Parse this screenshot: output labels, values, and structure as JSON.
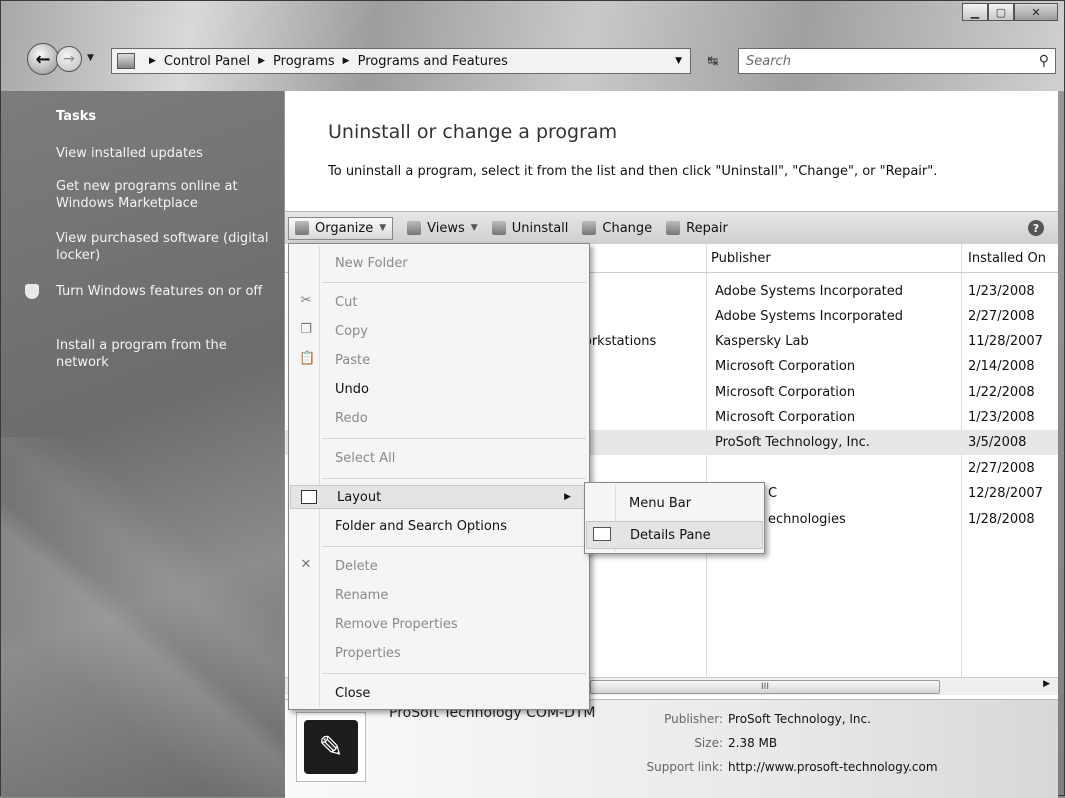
{
  "address": {
    "crumbs": [
      "Control Panel",
      "Programs",
      "Programs and Features"
    ],
    "search_placeholder": "Search"
  },
  "sidebar": {
    "heading": "Tasks",
    "items": [
      {
        "label": "View installed updates"
      },
      {
        "label": "Get new programs online at Windows Marketplace"
      },
      {
        "label": "View purchased software (digital locker)"
      },
      {
        "label": "Turn Windows features on or off"
      },
      {
        "label": "Install a program from the network"
      }
    ]
  },
  "main": {
    "title": "Uninstall or change a program",
    "description": "To uninstall a program, select it from the list and then click \"Uninstall\", \"Change\", or \"Repair\"."
  },
  "toolbar": {
    "organize": "Organize",
    "views": "Views",
    "uninstall": "Uninstall",
    "change": "Change",
    "repair": "Repair",
    "help": "?"
  },
  "table": {
    "columns": [
      "Publisher",
      "Installed On"
    ],
    "name_fragments": [
      "Vorkstations"
    ],
    "rows": [
      {
        "publisher": "Adobe Systems Incorporated",
        "installed": "1/23/2008"
      },
      {
        "publisher": "Adobe Systems Incorporated",
        "installed": "2/27/2008"
      },
      {
        "publisher": "Kaspersky Lab",
        "installed": "11/28/2007"
      },
      {
        "publisher": "Microsoft Corporation",
        "installed": "2/14/2008"
      },
      {
        "publisher": "Microsoft Corporation",
        "installed": "1/22/2008"
      },
      {
        "publisher": "Microsoft Corporation",
        "installed": "1/23/2008"
      },
      {
        "publisher": "ProSoft Technology, Inc.",
        "installed": "3/5/2008"
      },
      {
        "publisher": "",
        "installed": "2/27/2008"
      },
      {
        "publisher": "C",
        "installed": "12/28/2007"
      },
      {
        "publisher": "echnologies",
        "installed": "1/28/2008"
      }
    ]
  },
  "organize_menu": {
    "items": [
      {
        "label": "New Folder",
        "enabled": false
      },
      {
        "label": "Cut",
        "enabled": false
      },
      {
        "label": "Copy",
        "enabled": false
      },
      {
        "label": "Paste",
        "enabled": false
      },
      {
        "label": "Undo",
        "enabled": true
      },
      {
        "label": "Redo",
        "enabled": false
      },
      {
        "label": "Select All",
        "enabled": false
      },
      {
        "label": "Layout",
        "enabled": true
      },
      {
        "label": "Folder and Search Options",
        "enabled": true
      },
      {
        "label": "Delete",
        "enabled": false
      },
      {
        "label": "Rename",
        "enabled": false
      },
      {
        "label": "Remove Properties",
        "enabled": false
      },
      {
        "label": "Properties",
        "enabled": false
      },
      {
        "label": "Close",
        "enabled": true
      }
    ]
  },
  "layout_submenu": {
    "items": [
      {
        "label": "Menu Bar"
      },
      {
        "label": "Details Pane"
      }
    ]
  },
  "details": {
    "name": "ProSoft Technology COM-DTM",
    "publisher_label": "Publisher:",
    "publisher": "ProSoft Technology, Inc.",
    "size_label": "Size:",
    "size": "2.38 MB",
    "support_label": "Support link:",
    "support": "http://www.prosoft-technology.com"
  }
}
